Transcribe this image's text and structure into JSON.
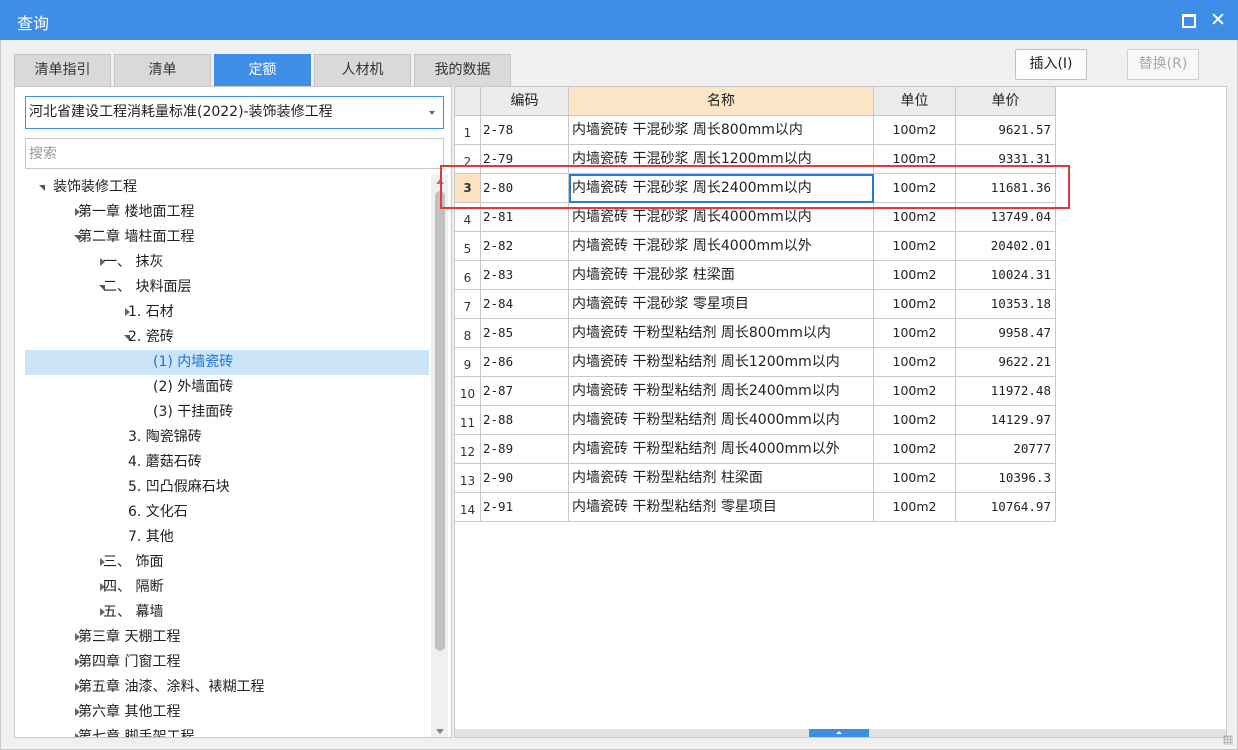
{
  "window": {
    "title": "查询"
  },
  "tabs": [
    {
      "label": "清单指引",
      "active": false
    },
    {
      "label": "清单",
      "active": false
    },
    {
      "label": "定额",
      "active": true
    },
    {
      "label": "人材机",
      "active": false
    },
    {
      "label": "我的数据",
      "active": false
    }
  ],
  "toolbar": {
    "insert_label": "插入(I)",
    "replace_label": "替换(R)"
  },
  "left": {
    "standard_select_value": "河北省建设工程消耗量标准(2022)-装饰装修工程",
    "search_placeholder": "搜索",
    "tree": [
      {
        "label": "装饰装修工程",
        "level": 0,
        "toggle": "expanded"
      },
      {
        "label": "第一章 楼地面工程",
        "level": 1,
        "toggle": "collapsed"
      },
      {
        "label": "第二章 墙柱面工程",
        "level": 1,
        "toggle": "expanded"
      },
      {
        "label": "一、 抹灰",
        "level": 2,
        "toggle": "collapsed"
      },
      {
        "label": "二、 块料面层",
        "level": 2,
        "toggle": "expanded"
      },
      {
        "label": "1. 石材",
        "level": 3,
        "toggle": "collapsed"
      },
      {
        "label": "2. 瓷砖",
        "level": 3,
        "toggle": "expanded"
      },
      {
        "label": "(1) 内墙瓷砖",
        "level": 4,
        "toggle": "none",
        "selected": true
      },
      {
        "label": "(2) 外墙面砖",
        "level": 4,
        "toggle": "none"
      },
      {
        "label": "(3) 干挂面砖",
        "level": 4,
        "toggle": "none"
      },
      {
        "label": "3. 陶瓷锦砖",
        "level": 3,
        "toggle": "none"
      },
      {
        "label": "4. 蘑菇石砖",
        "level": 3,
        "toggle": "none"
      },
      {
        "label": "5. 凹凸假麻石块",
        "level": 3,
        "toggle": "none"
      },
      {
        "label": "6. 文化石",
        "level": 3,
        "toggle": "none"
      },
      {
        "label": "7. 其他",
        "level": 3,
        "toggle": "none"
      },
      {
        "label": "三、 饰面",
        "level": 2,
        "toggle": "collapsed"
      },
      {
        "label": "四、 隔断",
        "level": 2,
        "toggle": "collapsed"
      },
      {
        "label": "五、 幕墙",
        "level": 2,
        "toggle": "collapsed"
      },
      {
        "label": "第三章 天棚工程",
        "level": 1,
        "toggle": "collapsed"
      },
      {
        "label": "第四章 门窗工程",
        "level": 1,
        "toggle": "collapsed"
      },
      {
        "label": "第五章 油漆、涂料、裱糊工程",
        "level": 1,
        "toggle": "collapsed"
      },
      {
        "label": "第六章 其他工程",
        "level": 1,
        "toggle": "collapsed"
      },
      {
        "label": "第七章 脚手架工程",
        "level": 1,
        "toggle": "collapsed"
      }
    ]
  },
  "table": {
    "columns": [
      "编码",
      "名称",
      "单位",
      "单价"
    ],
    "current_row": 3,
    "rows": [
      {
        "no": "1",
        "code": "2-78",
        "name": "内墙瓷砖 干混砂浆 周长800mm以内",
        "unit": "100m2",
        "price": "9621.57"
      },
      {
        "no": "2",
        "code": "2-79",
        "name": "内墙瓷砖 干混砂浆 周长1200mm以内",
        "unit": "100m2",
        "price": "9331.31"
      },
      {
        "no": "3",
        "code": "2-80",
        "name": "内墙瓷砖 干混砂浆 周长2400mm以内",
        "unit": "100m2",
        "price": "11681.36"
      },
      {
        "no": "4",
        "code": "2-81",
        "name": "内墙瓷砖 干混砂浆 周长4000mm以内",
        "unit": "100m2",
        "price": "13749.04"
      },
      {
        "no": "5",
        "code": "2-82",
        "name": "内墙瓷砖 干混砂浆 周长4000mm以外",
        "unit": "100m2",
        "price": "20402.01"
      },
      {
        "no": "6",
        "code": "2-83",
        "name": "内墙瓷砖 干混砂浆 柱梁面",
        "unit": "100m2",
        "price": "10024.31"
      },
      {
        "no": "7",
        "code": "2-84",
        "name": "内墙瓷砖 干混砂浆 零星项目",
        "unit": "100m2",
        "price": "10353.18"
      },
      {
        "no": "8",
        "code": "2-85",
        "name": "内墙瓷砖 干粉型粘结剂 周长800mm以内",
        "unit": "100m2",
        "price": "9958.47"
      },
      {
        "no": "9",
        "code": "2-86",
        "name": "内墙瓷砖 干粉型粘结剂 周长1200mm以内",
        "unit": "100m2",
        "price": "9622.21"
      },
      {
        "no": "10",
        "code": "2-87",
        "name": "内墙瓷砖 干粉型粘结剂 周长2400mm以内",
        "unit": "100m2",
        "price": "11972.48"
      },
      {
        "no": "11",
        "code": "2-88",
        "name": "内墙瓷砖 干粉型粘结剂 周长4000mm以内",
        "unit": "100m2",
        "price": "14129.97"
      },
      {
        "no": "12",
        "code": "2-89",
        "name": "内墙瓷砖 干粉型粘结剂 周长4000mm以外",
        "unit": "100m2",
        "price": "20777"
      },
      {
        "no": "13",
        "code": "2-90",
        "name": "内墙瓷砖 干粉型粘结剂 柱梁面",
        "unit": "100m2",
        "price": "10396.3"
      },
      {
        "no": "14",
        "code": "2-91",
        "name": "内墙瓷砖 干粉型粘结剂 零星项目",
        "unit": "100m2",
        "price": "10764.97"
      }
    ]
  },
  "colors": {
    "accent": "#3e8ee8",
    "highlight_border": "#e03a3a",
    "name_header_bg": "#fde6c8",
    "selected_tree_bg": "#cce4f8"
  }
}
